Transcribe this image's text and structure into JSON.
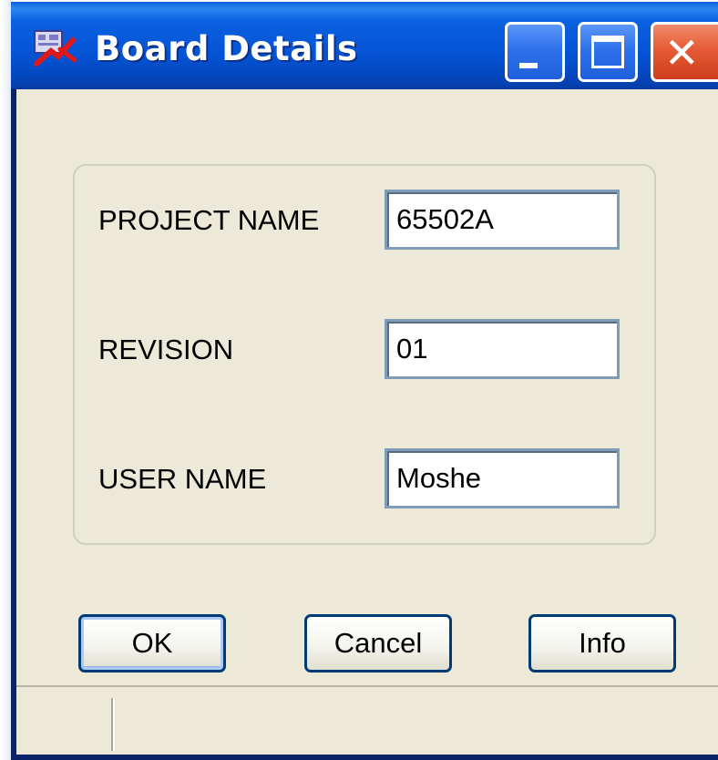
{
  "window": {
    "title": "Board Details",
    "icon": "board-app-icon"
  },
  "titlebar_buttons": {
    "minimize_icon": "minimize-icon",
    "maximize_icon": "maximize-icon",
    "close_icon": "close-icon",
    "close_glyph": "✕"
  },
  "form": {
    "project_name": {
      "label": "PROJECT NAME",
      "value": "65502A"
    },
    "revision": {
      "label": "REVISION",
      "value": "01"
    },
    "user_name": {
      "label": "USER NAME",
      "value": "Moshe"
    }
  },
  "buttons": {
    "ok": "OK",
    "cancel": "Cancel",
    "info": "Info"
  },
  "colors": {
    "titlebar": "#0554d6",
    "client_bg": "#ece9d8",
    "close_button": "#e55b35",
    "field_border": "#7f9db9",
    "button_border": "#003c74"
  }
}
